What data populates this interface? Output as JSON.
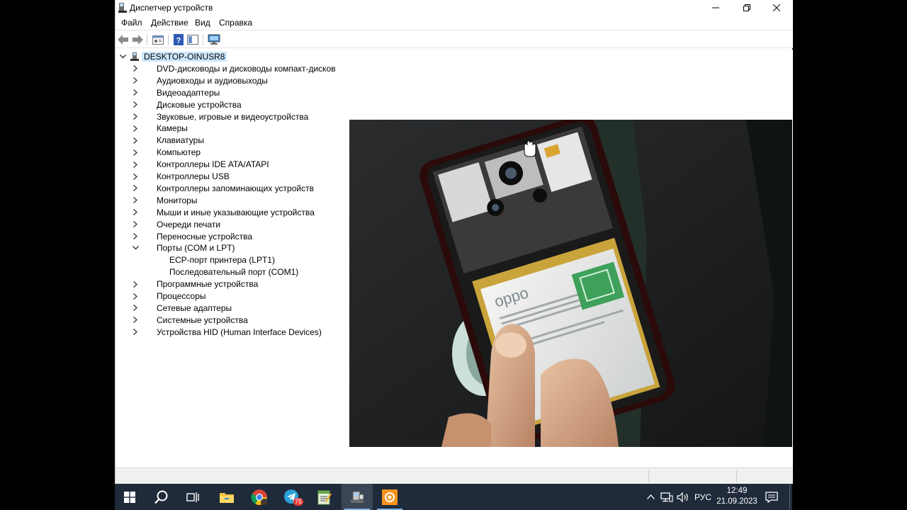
{
  "window": {
    "title": "Диспетчер устройств",
    "controls": [
      "minimize",
      "restore",
      "close"
    ]
  },
  "menu": {
    "items": [
      "Файл",
      "Действие",
      "Вид",
      "Справка"
    ]
  },
  "toolbar": {
    "buttons": [
      "back-icon",
      "forward-icon",
      "properties-icon",
      "help-icon",
      "toggle-pane-icon",
      "scan-hardware-icon"
    ]
  },
  "tree": {
    "root": "DESKTOP-OINUSR8",
    "categories": [
      {
        "label": "DVD-дисководы и дисководы компакт-дисков",
        "icon": "dvd-drive-icon",
        "expanded": false
      },
      {
        "label": "Аудиовходы и аудиовыходы",
        "icon": "speaker-icon",
        "expanded": false
      },
      {
        "label": "Видеоадаптеры",
        "icon": "display-adapter-icon",
        "expanded": false
      },
      {
        "label": "Дисковые устройства",
        "icon": "disk-drive-icon",
        "expanded": false
      },
      {
        "label": "Звуковые, игровые и видеоустройства",
        "icon": "sound-icon",
        "expanded": false
      },
      {
        "label": "Камеры",
        "icon": "camera-icon",
        "expanded": false
      },
      {
        "label": "Клавиатуры",
        "icon": "keyboard-icon",
        "expanded": false
      },
      {
        "label": "Компьютер",
        "icon": "computer-icon",
        "expanded": false
      },
      {
        "label": "Контроллеры IDE ATA/ATAPI",
        "icon": "ide-controller-icon",
        "expanded": false
      },
      {
        "label": "Контроллеры USB",
        "icon": "usb-icon",
        "expanded": false
      },
      {
        "label": "Контроллеры запоминающих устройств",
        "icon": "storage-controller-icon",
        "expanded": false
      },
      {
        "label": "Мониторы",
        "icon": "monitor-icon",
        "expanded": false
      },
      {
        "label": "Мыши и иные указывающие устройства",
        "icon": "mouse-icon",
        "expanded": false
      },
      {
        "label": "Очереди печати",
        "icon": "printer-icon",
        "expanded": false
      },
      {
        "label": "Переносные устройства",
        "icon": "portable-device-icon",
        "expanded": false
      },
      {
        "label": "Порты (COM и LPT)",
        "icon": "port-icon",
        "expanded": true,
        "children": [
          "ECP-порт принтера (LPT1)",
          "Последовательный порт (COM1)"
        ]
      },
      {
        "label": "Программные устройства",
        "icon": "software-device-icon",
        "expanded": false
      },
      {
        "label": "Процессоры",
        "icon": "processor-icon",
        "expanded": false
      },
      {
        "label": "Сетевые адаптеры",
        "icon": "network-adapter-icon",
        "expanded": false
      },
      {
        "label": "Системные устройства",
        "icon": "system-device-icon",
        "expanded": false
      },
      {
        "label": "Устройства HID (Human Interface Devices)",
        "icon": "hid-icon",
        "expanded": false
      }
    ]
  },
  "camera_overlay": {
    "brand_text": "oppo"
  },
  "taskbar": {
    "apps": [
      "start-icon",
      "search-icon",
      "task-view-icon",
      "file-explorer-icon",
      "chrome-icon",
      "telegram-icon",
      "notepad-icon",
      "device-manager-icon",
      "camera-app-icon"
    ],
    "telegram_badge": "75",
    "language": "РУС",
    "time": "12:49",
    "date": "21.09.2023"
  },
  "colors": {
    "accent": "#0078d7",
    "taskbar": "#1f2a3a",
    "selection": "#cce8ff"
  }
}
